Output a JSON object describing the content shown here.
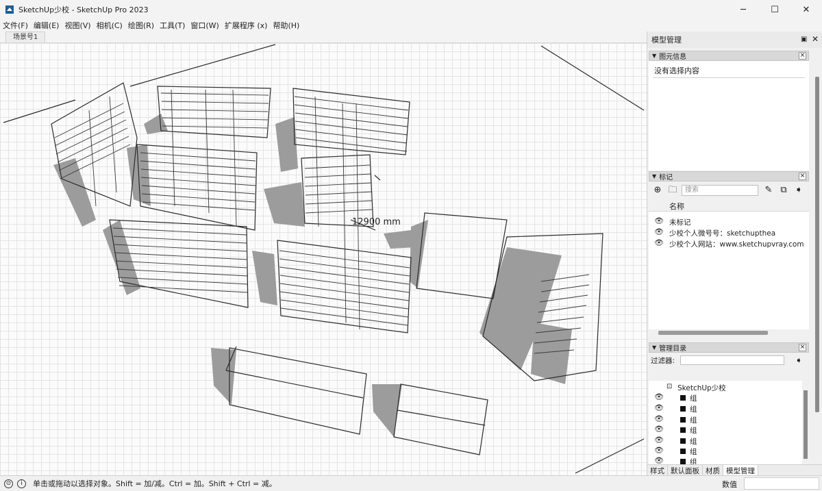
{
  "window": {
    "title": "SketchUp少校 - SketchUp Pro 2023",
    "minimize": "─",
    "maximize": "☐",
    "close": "✕"
  },
  "menu": [
    "文件(F)",
    "编辑(E)",
    "视图(V)",
    "相机(C)",
    "绘图(R)",
    "工具(T)",
    "窗口(W)",
    "扩展程序 (x)",
    "帮助(H)"
  ],
  "scene_tab": "场景号1",
  "viewport": {
    "dimension_label": "12900 mm"
  },
  "tray": {
    "title": "模型管理",
    "entity_info": {
      "header": "图元信息",
      "text": "没有选择内容"
    },
    "tags": {
      "header": "标记",
      "search_placeholder": "搜索",
      "column_name": "名称",
      "rows": [
        "未标记",
        "少校个人微号号：sketchupthea",
        "少校个人网站：www.sketchupvray.com"
      ]
    },
    "outliner": {
      "header": "管理目录",
      "filter_label": "过滤器:",
      "root": "SketchUp少校",
      "items": [
        "组",
        "组",
        "组",
        "组",
        "组",
        "组",
        "组"
      ]
    },
    "tabs": [
      "样式",
      "默认面板",
      "材质",
      "模型管理"
    ],
    "active_tab": "模型管理"
  },
  "status": {
    "message": "单击或拖动以选择对象。Shift = 加/减。Ctrl = 加。Shift + Ctrl = 减。",
    "vcb_label": "数值"
  }
}
